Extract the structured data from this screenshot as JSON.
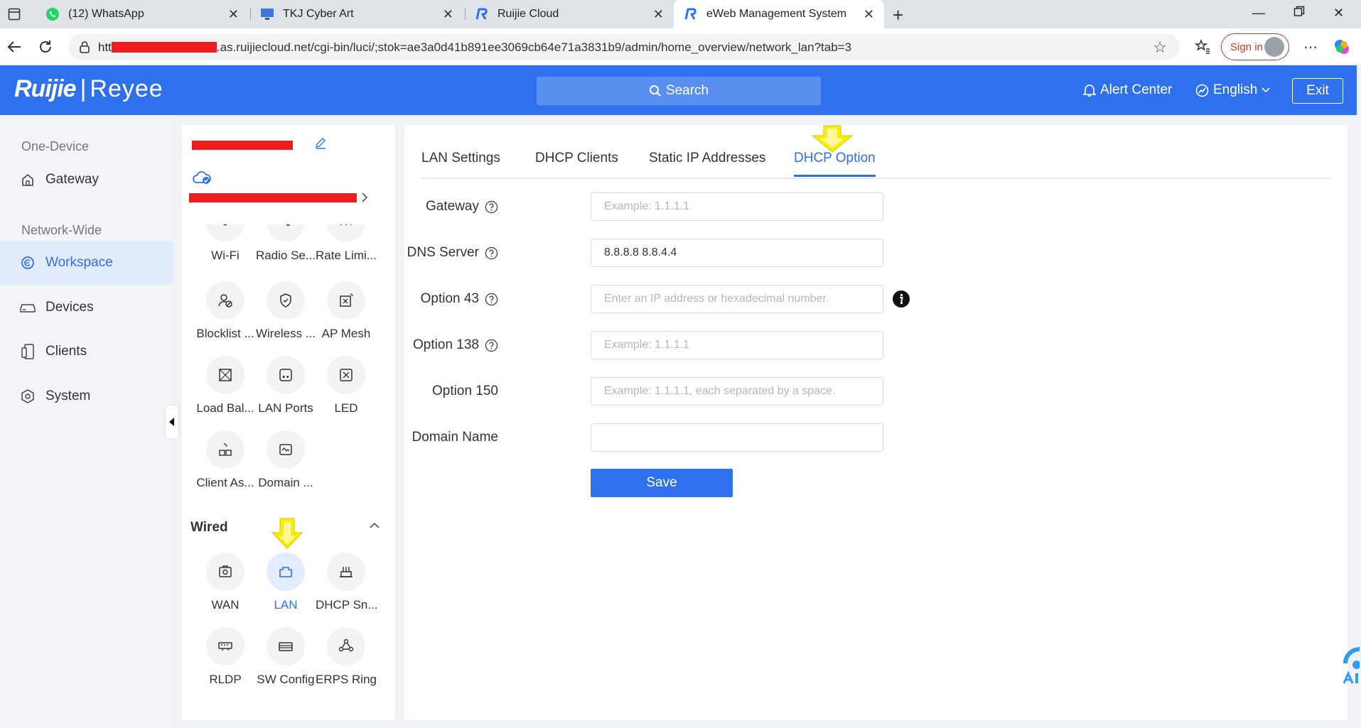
{
  "browser": {
    "tabs": [
      {
        "title": "(12) WhatsApp",
        "favicon": "whatsapp-icon"
      },
      {
        "title": "TKJ Cyber Art",
        "favicon": "monitor-icon"
      },
      {
        "title": "Ruijie Cloud",
        "favicon": "ruijie-icon"
      },
      {
        "title": "eWeb Management System",
        "favicon": "ruijie-icon",
        "active": true
      }
    ],
    "url_prefix": "htt",
    "url_rest": ".as.ruijiecloud.net/cgi-bin/luci/;stok=ae3a0d41b891ee3069cb64e71a3831b9/admin/home_overview/network_lan?tab=3",
    "signin_label": "Sign in"
  },
  "app": {
    "logo_brand": "Ruijie",
    "logo_product": "Reyee",
    "search_label": "Search",
    "alert_label": "Alert Center",
    "language_label": "English",
    "exit_label": "Exit",
    "accent": "#2f71ec"
  },
  "leftnav": {
    "group1": "One-Device",
    "gateway": "Gateway",
    "group2": "Network-Wide",
    "items": [
      {
        "label": "Workspace",
        "icon": "workspace-icon",
        "active": true
      },
      {
        "label": "Devices",
        "icon": "devices-icon"
      },
      {
        "label": "Clients",
        "icon": "clients-icon"
      },
      {
        "label": "System",
        "icon": "system-icon"
      }
    ]
  },
  "midpanel": {
    "tiles": [
      {
        "label": "Wi-Fi",
        "icon": "wifi-icon"
      },
      {
        "label": "Radio Se...",
        "icon": "radio-settings-icon"
      },
      {
        "label": "Rate Limi...",
        "icon": "rate-limit-icon"
      },
      {
        "label": "Blocklist ...",
        "icon": "blocklist-icon"
      },
      {
        "label": "Wireless ...",
        "icon": "wireless-security-icon"
      },
      {
        "label": "AP Mesh",
        "icon": "ap-mesh-icon"
      },
      {
        "label": "Load Bal...",
        "icon": "load-balance-icon"
      },
      {
        "label": "LAN Ports",
        "icon": "lan-ports-icon"
      },
      {
        "label": "LED",
        "icon": "led-icon"
      },
      {
        "label": "Client As...",
        "icon": "client-association-icon"
      },
      {
        "label": "Domain ...",
        "icon": "domain-icon"
      }
    ],
    "wired_title": "Wired",
    "wired_tiles": [
      {
        "label": "WAN",
        "icon": "wan-icon"
      },
      {
        "label": "LAN",
        "icon": "lan-icon",
        "active": true
      },
      {
        "label": "DHCP Sn...",
        "icon": "dhcp-snooping-icon"
      },
      {
        "label": "RLDP",
        "icon": "rldp-icon"
      },
      {
        "label": "SW Config",
        "icon": "switch-config-icon"
      },
      {
        "label": "ERPS Ring",
        "icon": "erps-ring-icon"
      }
    ]
  },
  "main": {
    "tabs": [
      "LAN Settings",
      "DHCP Clients",
      "Static IP Addresses",
      "DHCP Option"
    ],
    "active_tab": "DHCP Option",
    "fields": {
      "gateway": {
        "label": "Gateway",
        "value": "",
        "placeholder": "Example: 1.1.1.1"
      },
      "dns": {
        "label": "DNS Server",
        "value": "8.8.8.8 8.8.4.4",
        "placeholder": ""
      },
      "option43": {
        "label": "Option 43",
        "value": "",
        "placeholder": "Enter an IP address or hexadecimal number."
      },
      "option138": {
        "label": "Option 138",
        "value": "",
        "placeholder": "Example: 1.1.1.1"
      },
      "option150": {
        "label": "Option 150",
        "value": "",
        "placeholder": "Example: 1.1.1.1, each separated by a space."
      },
      "domain": {
        "label": "Domain Name",
        "value": "",
        "placeholder": ""
      }
    },
    "save_label": "Save"
  }
}
